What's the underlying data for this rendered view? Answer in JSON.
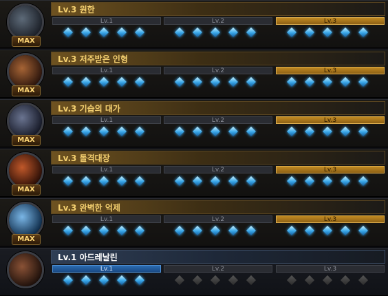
{
  "max_label": "MAX",
  "rows": [
    {
      "title": "Lv.3 원한",
      "active_level": 3,
      "maxed": true,
      "orb_colors": [
        "#5d6a78",
        "#1b1f27"
      ]
    },
    {
      "title": "Lv.3 저주받은 인형",
      "active_level": 3,
      "maxed": true,
      "orb_colors": [
        "#a66435",
        "#2a140c"
      ]
    },
    {
      "title": "Lv.3 기습의 대가",
      "active_level": 3,
      "maxed": true,
      "orb_colors": [
        "#6a7490",
        "#151826"
      ]
    },
    {
      "title": "Lv.3 돌격대장",
      "active_level": 3,
      "maxed": true,
      "orb_colors": [
        "#c0582a",
        "#2a0e06"
      ]
    },
    {
      "title": "Lv.3 완벽한 억제",
      "active_level": 3,
      "maxed": true,
      "orb_colors": [
        "#7ab6e6",
        "#0d2a48"
      ]
    },
    {
      "title": "Lv.1 아드레날린",
      "active_level": 1,
      "maxed": false,
      "orb_colors": [
        "#8a5236",
        "#1c0f0a"
      ]
    }
  ],
  "tier_labels": [
    "Lv.1",
    "Lv.2",
    "Lv.3"
  ],
  "gems_per_tier": 5
}
